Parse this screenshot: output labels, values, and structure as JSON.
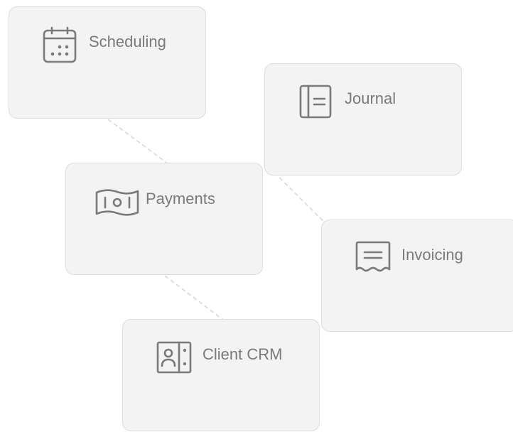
{
  "cards": [
    {
      "label": "Scheduling",
      "icon": "calendar-icon"
    },
    {
      "label": "Journal",
      "icon": "notebook-icon"
    },
    {
      "label": "Payments",
      "icon": "banknote-icon"
    },
    {
      "label": "Invoicing",
      "icon": "receipt-icon"
    },
    {
      "label": "Client CRM",
      "icon": "contact-card-icon"
    }
  ],
  "colors": {
    "card_background": "#f3f3f3",
    "card_border": "#dedede",
    "text": "#7a7a7a",
    "icon": "#7a7a7a",
    "connector": "#d6d6d6"
  }
}
